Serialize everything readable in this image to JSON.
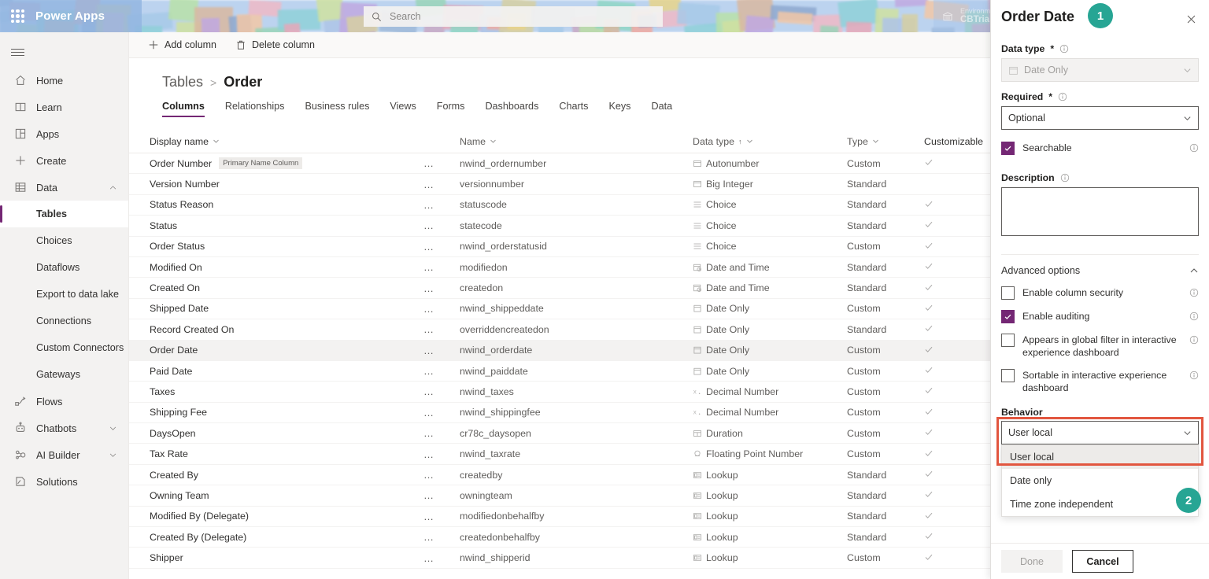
{
  "suitebar": {
    "brand": "Power Apps",
    "waffle_icon": "waffle-icon",
    "search": {
      "placeholder": "Search",
      "value": "",
      "icon": "search-icon"
    },
    "environment": {
      "caption": "Environment",
      "name": "CBTrial",
      "icon": "environment-icon"
    }
  },
  "rail": {
    "hamburger_icon": "hamburger-icon",
    "items": [
      {
        "label": "Home",
        "icon": "home-icon",
        "level": "top",
        "chevron": "",
        "active": false
      },
      {
        "label": "Learn",
        "icon": "learn-icon",
        "level": "top",
        "chevron": "",
        "active": false
      },
      {
        "label": "Apps",
        "icon": "apps-icon",
        "level": "top",
        "chevron": "",
        "active": false
      },
      {
        "label": "Create",
        "icon": "plus-icon",
        "level": "top",
        "chevron": "",
        "active": false
      },
      {
        "label": "Data",
        "icon": "data-grid-icon",
        "level": "top",
        "chevron": "chevron-up-icon",
        "active": false
      },
      {
        "label": "Tables",
        "icon": "",
        "level": "sub",
        "chevron": "",
        "active": true
      },
      {
        "label": "Choices",
        "icon": "",
        "level": "sub",
        "chevron": "",
        "active": false
      },
      {
        "label": "Dataflows",
        "icon": "",
        "level": "sub",
        "chevron": "",
        "active": false
      },
      {
        "label": "Export to data lake",
        "icon": "",
        "level": "sub",
        "chevron": "",
        "active": false
      },
      {
        "label": "Connections",
        "icon": "",
        "level": "sub",
        "chevron": "",
        "active": false
      },
      {
        "label": "Custom Connectors",
        "icon": "",
        "level": "sub",
        "chevron": "",
        "active": false
      },
      {
        "label": "Gateways",
        "icon": "",
        "level": "sub",
        "chevron": "",
        "active": false
      },
      {
        "label": "Flows",
        "icon": "flows-icon",
        "level": "top",
        "chevron": "",
        "active": false
      },
      {
        "label": "Chatbots",
        "icon": "chatbot-icon",
        "level": "top",
        "chevron": "chevron-down-icon",
        "active": false
      },
      {
        "label": "AI Builder",
        "icon": "ai-builder-icon",
        "level": "top",
        "chevron": "chevron-down-icon",
        "active": false
      },
      {
        "label": "Solutions",
        "icon": "solutions-icon",
        "level": "top",
        "chevron": "",
        "active": false
      }
    ]
  },
  "commandbar": {
    "add_column": "Add column",
    "add_column_icon": "plus-icon",
    "delete_column": "Delete column",
    "delete_column_icon": "trash-icon"
  },
  "breadcrumb": {
    "root": "Tables",
    "separator": ">",
    "current": "Order"
  },
  "tabs": [
    {
      "label": "Columns",
      "selected": true
    },
    {
      "label": "Relationships",
      "selected": false
    },
    {
      "label": "Business rules",
      "selected": false
    },
    {
      "label": "Views",
      "selected": false
    },
    {
      "label": "Forms",
      "selected": false
    },
    {
      "label": "Dashboards",
      "selected": false
    },
    {
      "label": "Charts",
      "selected": false
    },
    {
      "label": "Keys",
      "selected": false
    },
    {
      "label": "Data",
      "selected": false
    }
  ],
  "grid": {
    "columns": [
      {
        "label": "Display name",
        "sorted": "",
        "chevron": "chevron-down-icon"
      },
      {
        "label": "Name",
        "sorted": "",
        "chevron": "chevron-down-icon"
      },
      {
        "label": "Data type",
        "sorted": "↑",
        "chevron": "chevron-down-icon"
      },
      {
        "label": "Type",
        "sorted": "",
        "chevron": "chevron-down-icon"
      },
      {
        "label": "Customizable",
        "sorted": "",
        "chevron": ""
      }
    ],
    "overflow_glyph": "…",
    "rows": [
      {
        "display_name": "Order Number",
        "badge": "Primary Name Column",
        "name": "nwind_ordernumber",
        "data_type": "Autonumber",
        "type": "Custom",
        "customizable": true,
        "selected": false
      },
      {
        "display_name": "Version Number",
        "badge": "",
        "name": "versionnumber",
        "data_type": "Big Integer",
        "type": "Standard",
        "customizable": false,
        "selected": false
      },
      {
        "display_name": "Status Reason",
        "badge": "",
        "name": "statuscode",
        "data_type": "Choice",
        "type": "Standard",
        "customizable": true,
        "selected": false
      },
      {
        "display_name": "Status",
        "badge": "",
        "name": "statecode",
        "data_type": "Choice",
        "type": "Standard",
        "customizable": true,
        "selected": false
      },
      {
        "display_name": "Order Status",
        "badge": "",
        "name": "nwind_orderstatusid",
        "data_type": "Choice",
        "type": "Custom",
        "customizable": true,
        "selected": false
      },
      {
        "display_name": "Modified On",
        "badge": "",
        "name": "modifiedon",
        "data_type": "Date and Time",
        "type": "Standard",
        "customizable": true,
        "selected": false
      },
      {
        "display_name": "Created On",
        "badge": "",
        "name": "createdon",
        "data_type": "Date and Time",
        "type": "Standard",
        "customizable": true,
        "selected": false
      },
      {
        "display_name": "Shipped Date",
        "badge": "",
        "name": "nwind_shippeddate",
        "data_type": "Date Only",
        "type": "Custom",
        "customizable": true,
        "selected": false
      },
      {
        "display_name": "Record Created On",
        "badge": "",
        "name": "overriddencreatedon",
        "data_type": "Date Only",
        "type": "Standard",
        "customizable": true,
        "selected": false
      },
      {
        "display_name": "Order Date",
        "badge": "",
        "name": "nwind_orderdate",
        "data_type": "Date Only",
        "type": "Custom",
        "customizable": true,
        "selected": true
      },
      {
        "display_name": "Paid Date",
        "badge": "",
        "name": "nwind_paiddate",
        "data_type": "Date Only",
        "type": "Custom",
        "customizable": true,
        "selected": false
      },
      {
        "display_name": "Taxes",
        "badge": "",
        "name": "nwind_taxes",
        "data_type": "Decimal Number",
        "type": "Custom",
        "customizable": true,
        "selected": false
      },
      {
        "display_name": "Shipping Fee",
        "badge": "",
        "name": "nwind_shippingfee",
        "data_type": "Decimal Number",
        "type": "Custom",
        "customizable": true,
        "selected": false
      },
      {
        "display_name": "DaysOpen",
        "badge": "",
        "name": "cr78c_daysopen",
        "data_type": "Duration",
        "type": "Custom",
        "customizable": true,
        "selected": false
      },
      {
        "display_name": "Tax Rate",
        "badge": "",
        "name": "nwind_taxrate",
        "data_type": "Floating Point Number",
        "type": "Custom",
        "customizable": true,
        "selected": false
      },
      {
        "display_name": "Created By",
        "badge": "",
        "name": "createdby",
        "data_type": "Lookup",
        "type": "Standard",
        "customizable": true,
        "selected": false
      },
      {
        "display_name": "Owning Team",
        "badge": "",
        "name": "owningteam",
        "data_type": "Lookup",
        "type": "Standard",
        "customizable": true,
        "selected": false
      },
      {
        "display_name": "Modified By (Delegate)",
        "badge": "",
        "name": "modifiedonbehalfby",
        "data_type": "Lookup",
        "type": "Standard",
        "customizable": true,
        "selected": false
      },
      {
        "display_name": "Created By (Delegate)",
        "badge": "",
        "name": "createdonbehalfby",
        "data_type": "Lookup",
        "type": "Standard",
        "customizable": true,
        "selected": false
      },
      {
        "display_name": "Shipper",
        "badge": "",
        "name": "nwind_shipperid",
        "data_type": "Lookup",
        "type": "Custom",
        "customizable": true,
        "selected": false
      }
    ]
  },
  "panel": {
    "title": "Order Date",
    "close_icon": "close-icon",
    "data_type": {
      "label": "Data type",
      "required_mark": "*",
      "value": "Date Only",
      "icon": "date-only-icon",
      "disabled": true
    },
    "required": {
      "label": "Required",
      "required_mark": "*",
      "value": "Optional"
    },
    "searchable": {
      "label": "Searchable",
      "checked": true
    },
    "description": {
      "label": "Description",
      "value": "",
      "placeholder": ""
    },
    "advanced_options": {
      "label": "Advanced options",
      "expanded": true,
      "chevron": "chevron-up-icon"
    },
    "checkboxes": [
      {
        "label": "Enable column security",
        "checked": false
      },
      {
        "label": "Enable auditing",
        "checked": true
      },
      {
        "label": "Appears in global filter in interactive experience dashboard",
        "checked": false
      },
      {
        "label": "Sortable in interactive experience dashboard",
        "checked": false
      }
    ],
    "behavior": {
      "label": "Behavior",
      "value": "User local",
      "open": true,
      "options": [
        {
          "label": "User local",
          "highlighted": true
        },
        {
          "label": "Date only",
          "highlighted": false
        },
        {
          "label": "Time zone independent",
          "highlighted": false
        }
      ]
    },
    "footer": {
      "done": "Done",
      "done_disabled": true,
      "cancel": "Cancel"
    }
  },
  "annotations": {
    "step1": "1",
    "step2": "2",
    "badge_color": "#27a594",
    "highlight_color": "#e2563f",
    "accent_color": "#742774"
  }
}
